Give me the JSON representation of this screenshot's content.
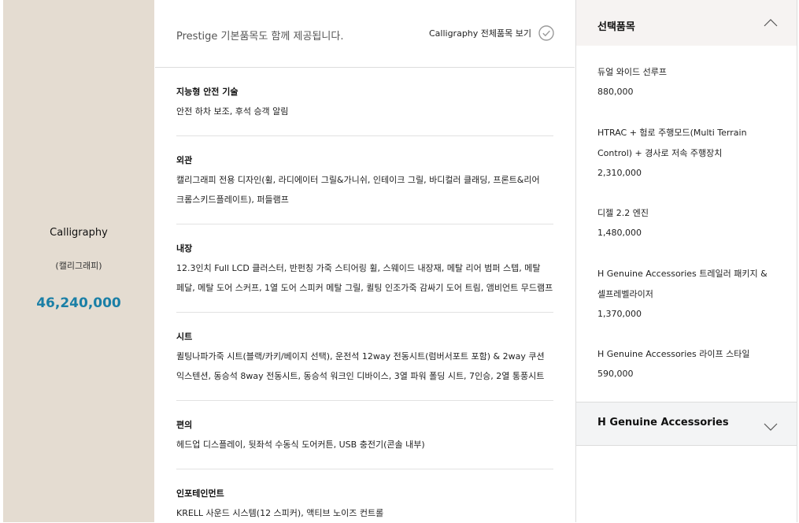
{
  "trim": {
    "name": "Calligraphy",
    "subtitle": "(캘리그래피)",
    "price": "46,240,000"
  },
  "notice": {
    "text": "Prestige 기본품목도 함께 제공됩니다.",
    "view_all_label": "Calligraphy 전체품목 보기",
    "view_all_icon": "check-circle-icon"
  },
  "spec_sections": [
    {
      "title": "지능형 안전 기술",
      "lines": [
        "안전 하차 보조, 후석 승객 알림"
      ]
    },
    {
      "title": "외관",
      "lines": [
        "캘리그래피 전용 디자인(휠, 라디에이터 그릴&가니쉬, 인테이크 그릴, 바디컬러 클래딩, 프론트&리어",
        "크롬스키드플레이트), 퍼들램프"
      ]
    },
    {
      "title": "내장",
      "lines": [
        "12.3인치 Full LCD 클러스터, 반펀칭 가죽 스티어링 휠, 스웨이드 내장재, 메탈 리어 범퍼 스텝, 메탈",
        "페달, 메탈 도어 스커프, 1열 도어 스피커 메탈 그릴, 퀼팅 인조가죽 감싸기 도어 트림, 앰비언트 무드램프"
      ]
    },
    {
      "title": "시트",
      "lines": [
        "퀼팅나파가죽 시트(블랙/카키/베이지 선택), 운전석 12way 전동시트(럼버서포트 포함) & 2way 쿠션",
        "익스텐션, 동승석 8way 전동시트, 동승석 워크인 디바이스, 3열 파워 폴딩 시트, 7인승, 2열 통풍시트"
      ]
    },
    {
      "title": "편의",
      "lines": [
        "헤드업 디스플레이, 뒷좌석 수동식 도어커튼, USB 충전기(콘솔 내부)"
      ]
    },
    {
      "title": "인포테인먼트",
      "lines": [
        "KRELL 사운드 시스템(12 스피커), 액티브 노이즈 컨트롤"
      ]
    }
  ],
  "selected_panel": {
    "title": "선택품목",
    "toggle_icon": "chevron-up-icon",
    "options": [
      {
        "name_lines": [
          "듀얼 와이드 선루프"
        ],
        "price": "880,000"
      },
      {
        "name_lines": [
          "HTRAC + 험로 주행모드(Multi Terrain",
          "Control) + 경사로 저속 주행장치"
        ],
        "price": "2,310,000"
      },
      {
        "name_lines": [
          "디젤 2.2 엔진"
        ],
        "price": "1,480,000"
      },
      {
        "name_lines": [
          "H Genuine Accessories 트레일러 패키지 &",
          "셀프레벨라이저"
        ],
        "price": "1,370,000"
      },
      {
        "name_lines": [
          "H Genuine Accessories 라이프 스타일"
        ],
        "price": "590,000"
      }
    ]
  },
  "accessories_panel": {
    "title": "H Genuine Accessories",
    "toggle_icon": "chevron-down-icon"
  },
  "colors": {
    "trim_panel_bg": "#e4dcd1",
    "price_accent": "#1a7fa6",
    "panel_head_bg": "#f6f3f2"
  }
}
